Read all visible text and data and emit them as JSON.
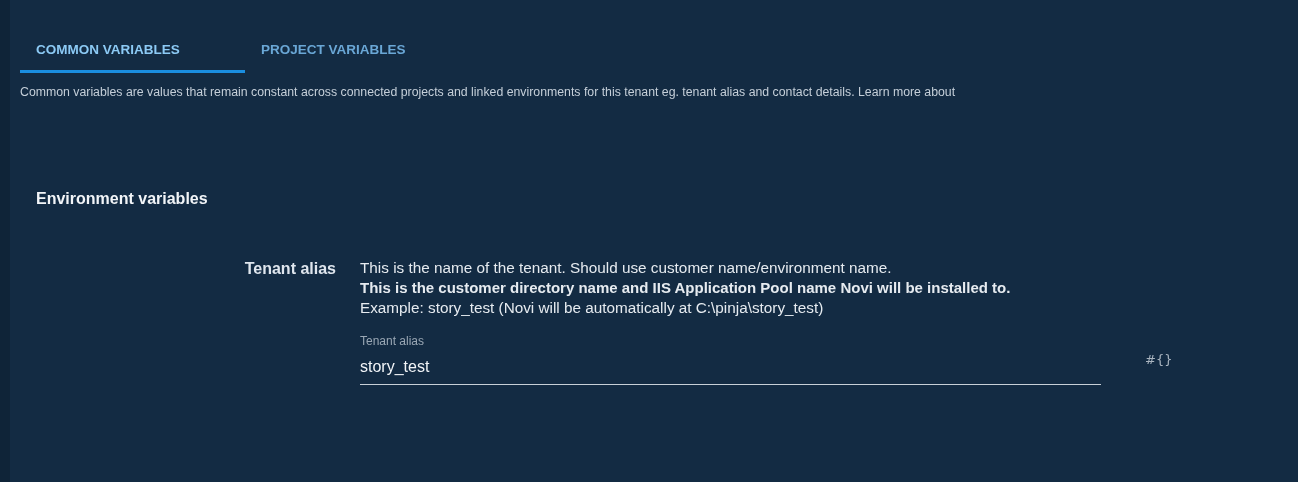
{
  "tabs": [
    {
      "label": "COMMON VARIABLES",
      "selected": true
    },
    {
      "label": "PROJECT VARIABLES",
      "selected": false
    }
  ],
  "intro": "Common variables are values that remain constant across connected projects and linked environments for this tenant eg. tenant alias and contact details. Learn more about",
  "section": {
    "title": "Environment variables",
    "variables": [
      {
        "name": "Tenant alias",
        "description": [
          {
            "text": "This is the name of the tenant. Should use customer name/environment name.",
            "bold": false
          },
          {
            "text": "This is the customer directory name and IIS Application Pool name Novi will be installed to.",
            "bold": true
          },
          {
            "text": "Example: story_test (Novi will be automatically at C:\\pinja\\story_test)",
            "bold": false
          }
        ],
        "field": {
          "label": "Tenant alias",
          "value": "story_test"
        },
        "insert_symbol": "#{}"
      }
    ]
  }
}
